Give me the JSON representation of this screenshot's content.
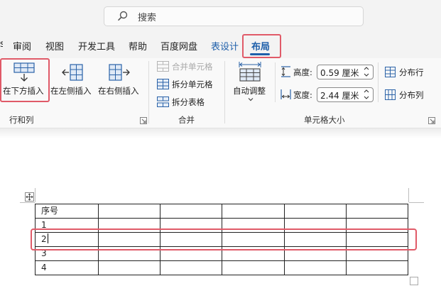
{
  "search": {
    "placeholder": "搜索"
  },
  "tabs": [
    {
      "label": "审阅"
    },
    {
      "label": "视图"
    },
    {
      "label": "开发工具"
    },
    {
      "label": "帮助"
    },
    {
      "label": "百度网盘"
    },
    {
      "label": "表设计"
    },
    {
      "label": "布局",
      "selected": true
    }
  ],
  "ribbon": {
    "rows_columns": {
      "group_label": "行和列",
      "insert_below": "在下方插入",
      "insert_left": "在左侧插入",
      "insert_right": "在右侧插入"
    },
    "merge": {
      "group_label": "合并",
      "merge_cells": "合并单元格",
      "merge_cells_enabled": false,
      "split_cells": "拆分单元格",
      "split_table": "拆分表格"
    },
    "cell_size": {
      "group_label": "单元格大小",
      "autofit": "自动调整",
      "height_label": "高度:",
      "height_value": "0.59 厘米",
      "width_label": "宽度:",
      "width_value": "2.44 厘米",
      "distribute_rows": "分布行",
      "distribute_columns": "分布列"
    }
  },
  "document": {
    "table": {
      "rows": [
        [
          "序号",
          "",
          "",
          "",
          "",
          ""
        ],
        [
          "1",
          "",
          "",
          "",
          "",
          ""
        ],
        [
          "2",
          "",
          "",
          "",
          "",
          ""
        ],
        [
          "3",
          "",
          "",
          "",
          "",
          ""
        ],
        [
          "4",
          "",
          "",
          "",
          "",
          ""
        ]
      ],
      "active_row": 2
    }
  },
  "colors": {
    "accent": "#1e5faa",
    "highlight": "#e05a68"
  }
}
